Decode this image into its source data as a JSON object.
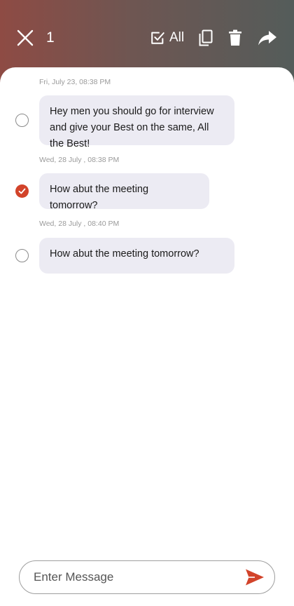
{
  "header": {
    "selected_count": "1",
    "select_all_label": "All"
  },
  "messages": [
    {
      "timestamp": "Fri, July 23, 08:38 PM",
      "text": "Hey men you should go for interview and give your Best on the same, All the Best!",
      "selected": false
    },
    {
      "timestamp": "Wed, 28 July , 08:38 PM",
      "text": "How abut the meeting tomorrow?",
      "selected": true
    },
    {
      "timestamp": "Wed, 28 July , 08:40 PM",
      "text": "How abut the meeting tomorrow?",
      "selected": false
    }
  ],
  "composer": {
    "placeholder": "Enter Message",
    "value": ""
  },
  "colors": {
    "accent": "#d2432a",
    "bubble": "#ecebf3",
    "header_gradient_start": "#8e4b44",
    "header_gradient_end": "#545c5a"
  }
}
